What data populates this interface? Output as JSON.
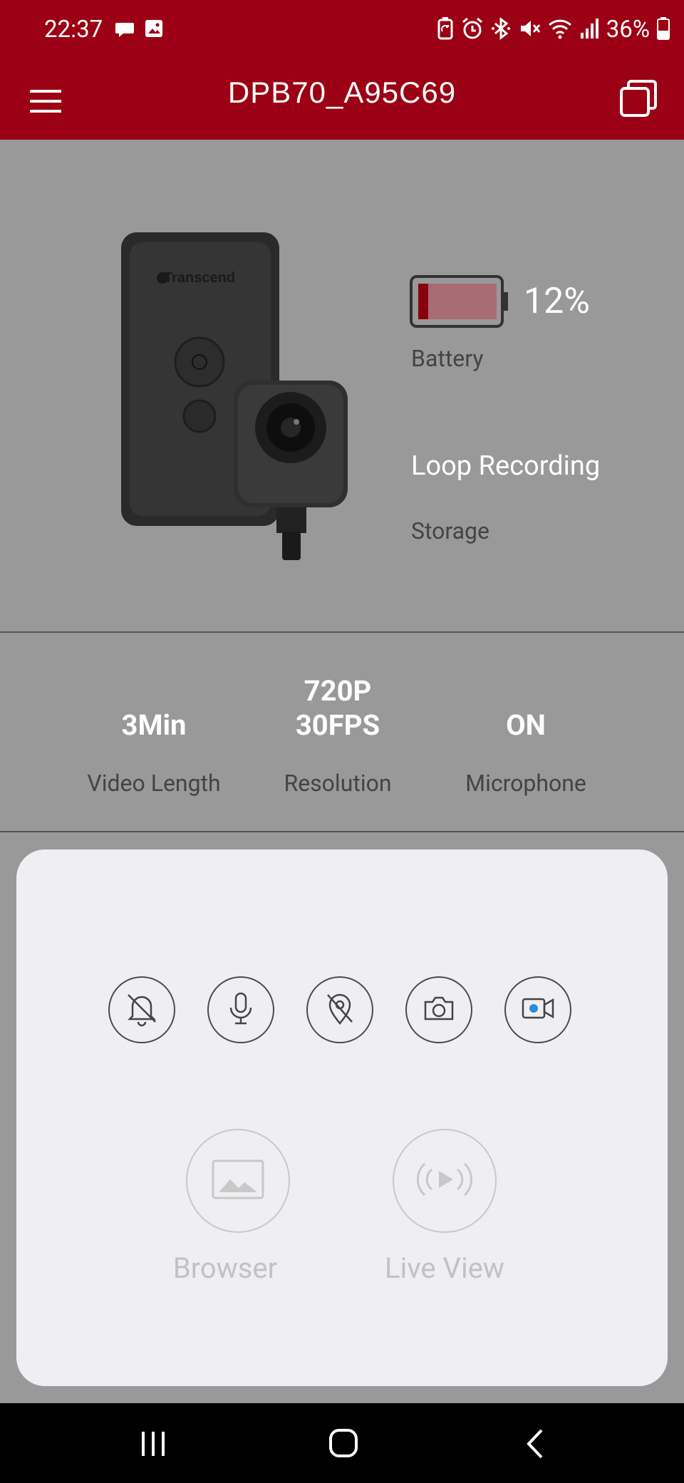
{
  "status_bar": {
    "time": "22:37",
    "battery_percent": "36%",
    "left_icons": [
      "chat-bubble-icon",
      "image-icon"
    ],
    "right_icons": [
      "recycle-battery-icon",
      "alarm-icon",
      "bluetooth-icon",
      "mute-icon",
      "wifi-icon",
      "signal-icon",
      "battery-icon"
    ]
  },
  "app_bar": {
    "title": "DPB70_A95C69",
    "left_icon": "hamburger-menu-icon",
    "right_icon": "copy-windows-icon",
    "background": "#9b0014"
  },
  "device": {
    "battery_value": "12%",
    "battery_level": 0.12,
    "battery_label": "Battery",
    "recording_mode": "Loop Recording",
    "storage_label": "Storage"
  },
  "settings": {
    "video_length": {
      "value": "3Min",
      "label": "Video Length"
    },
    "resolution": {
      "value_line1": "720P",
      "value_line2": "30FPS",
      "label": "Resolution"
    },
    "microphone": {
      "value": "ON",
      "label": "Microphone"
    }
  },
  "actions": {
    "icons": [
      "bell-off-icon",
      "microphone-icon",
      "location-off-icon",
      "camera-icon",
      "video-record-icon"
    ],
    "record_dot_color": "#2a8cde"
  },
  "panel_buttons": {
    "browser_label": "Browser",
    "live_view_label": "Live View"
  },
  "nav_bar": {
    "icons": [
      "recents-icon",
      "home-icon",
      "back-icon"
    ]
  }
}
